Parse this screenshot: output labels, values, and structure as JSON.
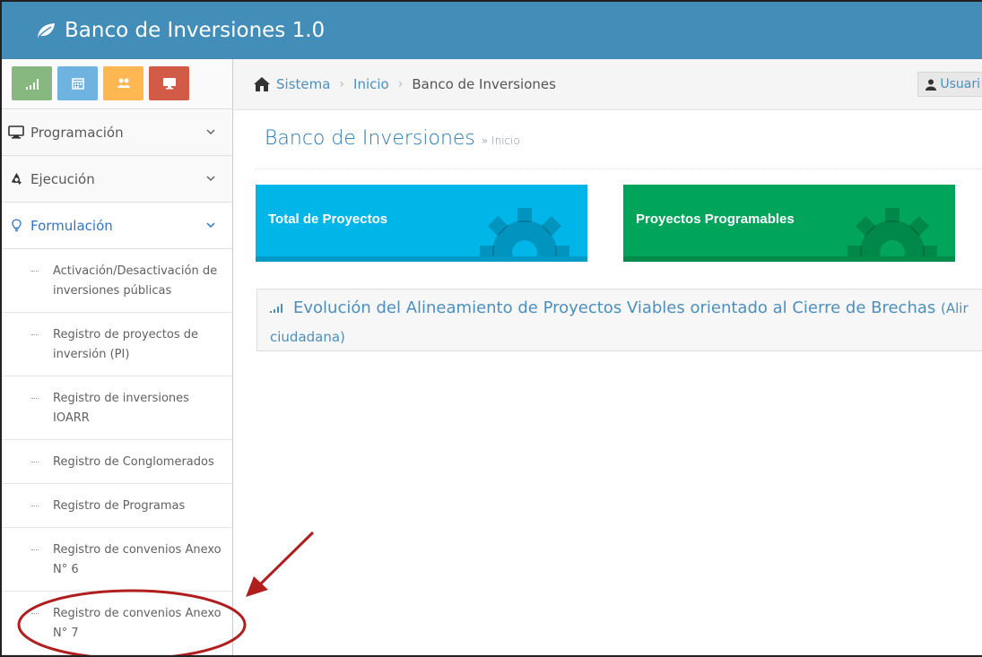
{
  "app": {
    "title": "Banco de Inversiones 1.0"
  },
  "shortcuts": [
    {
      "icon": "signal-icon",
      "color": "#87b87f"
    },
    {
      "icon": "calendar-icon",
      "color": "#6fb3e0"
    },
    {
      "icon": "users-icon",
      "color": "#ffb752"
    },
    {
      "icon": "monitor-icon",
      "color": "#d15b47"
    }
  ],
  "sidebar": {
    "items": [
      {
        "label": "Programación",
        "icon": "desktop-icon"
      },
      {
        "label": "Ejecución",
        "icon": "recycle-icon"
      },
      {
        "label": "Formulación",
        "icon": "lightbulb-icon",
        "active": true
      }
    ],
    "subitems": [
      "Activación/Desactivación de inversiones públicas",
      "Registro de proyectos de inversión (PI)",
      "Registro de inversiones IOARR",
      "Registro de Conglomerados",
      "Registro de Programas",
      "Registro de convenios Anexo N° 6",
      "Registro de convenios Anexo N° 7"
    ]
  },
  "breadcrumb": {
    "items": [
      "Sistema",
      "Inicio",
      "Banco de Inversiones"
    ],
    "user": "Usuari"
  },
  "main": {
    "title": "Banco de Inversiones",
    "subtitle": "» Inicio",
    "tiles": [
      {
        "title": "Total de Proyectos",
        "color": "#00b5e8"
      },
      {
        "title": "Proyectos Programables",
        "color": "#00a55b"
      }
    ],
    "panel": {
      "title": "Evolución del Alineamiento de Proyectos Viables orientado al Cierre de Brechas",
      "title_paren": "(Alir",
      "subtitle": "ciudadana)"
    }
  },
  "annotation": {
    "color": "#b01e1e"
  }
}
